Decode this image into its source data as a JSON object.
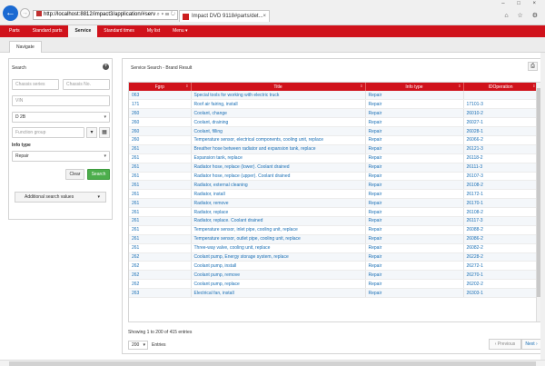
{
  "browser": {
    "address": "http://localhost:8812/impact3/application/#serv",
    "address_tools": "⌕ ▾ ☰ ↻",
    "tab_title": "Impact DVD 9118#parts/det...",
    "tab_close": "×",
    "window_controls": "– □ ×",
    "toolbar_icons": "⌂ ☆ ⚙"
  },
  "nav": {
    "items": [
      "Parts",
      "Standard parts",
      "Service",
      "Standard times",
      "My list",
      "Menu ▾"
    ],
    "active": "Service"
  },
  "subtab": {
    "label": "Navigate"
  },
  "search_panel": {
    "title": "Search",
    "chassis_series_placeholder": "Chassis series",
    "chassis_no_placeholder": "Chassis No.",
    "vin_placeholder": "VIN",
    "model_value": "D 2B",
    "function_group_placeholder": "Function group",
    "info_type_label": "Info type",
    "info_type_value": "Repair",
    "clear_label": "Clear",
    "search_label": "Search",
    "additional_label": "Additional search values"
  },
  "results": {
    "header": "Service Search - Brand Result",
    "columns": [
      "Fgrp",
      "Title",
      "Info type",
      "IDOperation"
    ],
    "rows": [
      [
        "063",
        "Special tools for working with electric truck",
        "Repair",
        ""
      ],
      [
        "171",
        "Roof air fairing, install",
        "Repair",
        "17101-3"
      ],
      [
        "260",
        "Coolant, change",
        "Repair",
        "26010-2"
      ],
      [
        "260",
        "Coolant, draining",
        "Repair",
        "26027-1"
      ],
      [
        "260",
        "Coolant, filling",
        "Repair",
        "26028-1"
      ],
      [
        "260",
        "Temperature sensor, electrical components, cooling unit, replace",
        "Repair",
        "26066-2"
      ],
      [
        "261",
        "Breather hose between radiator and expansion tank, replace",
        "Repair",
        "26121-3"
      ],
      [
        "261",
        "Expansion tank, replace",
        "Repair",
        "26118-2"
      ],
      [
        "261",
        "Radiator hose, replace (lower). Coolant drained",
        "Repair",
        "26111-3"
      ],
      [
        "261",
        "Radiator hose, replace (upper). Coolant drained",
        "Repair",
        "26107-3"
      ],
      [
        "261",
        "Radiator, external cleaning",
        "Repair",
        "26108-2"
      ],
      [
        "261",
        "Radiator, install",
        "Repair",
        "26172-1"
      ],
      [
        "261",
        "Radiator, remove",
        "Repair",
        "26170-1"
      ],
      [
        "261",
        "Radiator, replace",
        "Repair",
        "26108-2"
      ],
      [
        "261",
        "Radiator, replace. Coolant drained",
        "Repair",
        "26117-3"
      ],
      [
        "261",
        "Temperature sensor, inlet pipe, cooling unit, replace",
        "Repair",
        "26088-2"
      ],
      [
        "261",
        "Temperature sensor, outlet pipe, cooling unit, replace",
        "Repair",
        "26086-2"
      ],
      [
        "261",
        "Three-way valve, cooling unit, replace",
        "Repair",
        "26082-2"
      ],
      [
        "262",
        "Coolant pump, Energy storage system, replace",
        "Repair",
        "26228-2"
      ],
      [
        "262",
        "Coolant pump, install",
        "Repair",
        "26272-1"
      ],
      [
        "262",
        "Coolant pump, remove",
        "Repair",
        "26270-1"
      ],
      [
        "262",
        "Coolant pump, replace",
        "Repair",
        "26202-2"
      ],
      [
        "263",
        "Electrical fan, install",
        "Repair",
        "26303-1"
      ]
    ],
    "showing": "Showing 1 to 200 of 415 entries",
    "page_size": "200",
    "entries_label": "Entries",
    "previous_label": "‹ Previous",
    "next_label": "Next ›"
  },
  "colors": {
    "brand_red": "#d0121b",
    "link_blue": "#1a6fb5",
    "search_green": "#4cae4c"
  }
}
